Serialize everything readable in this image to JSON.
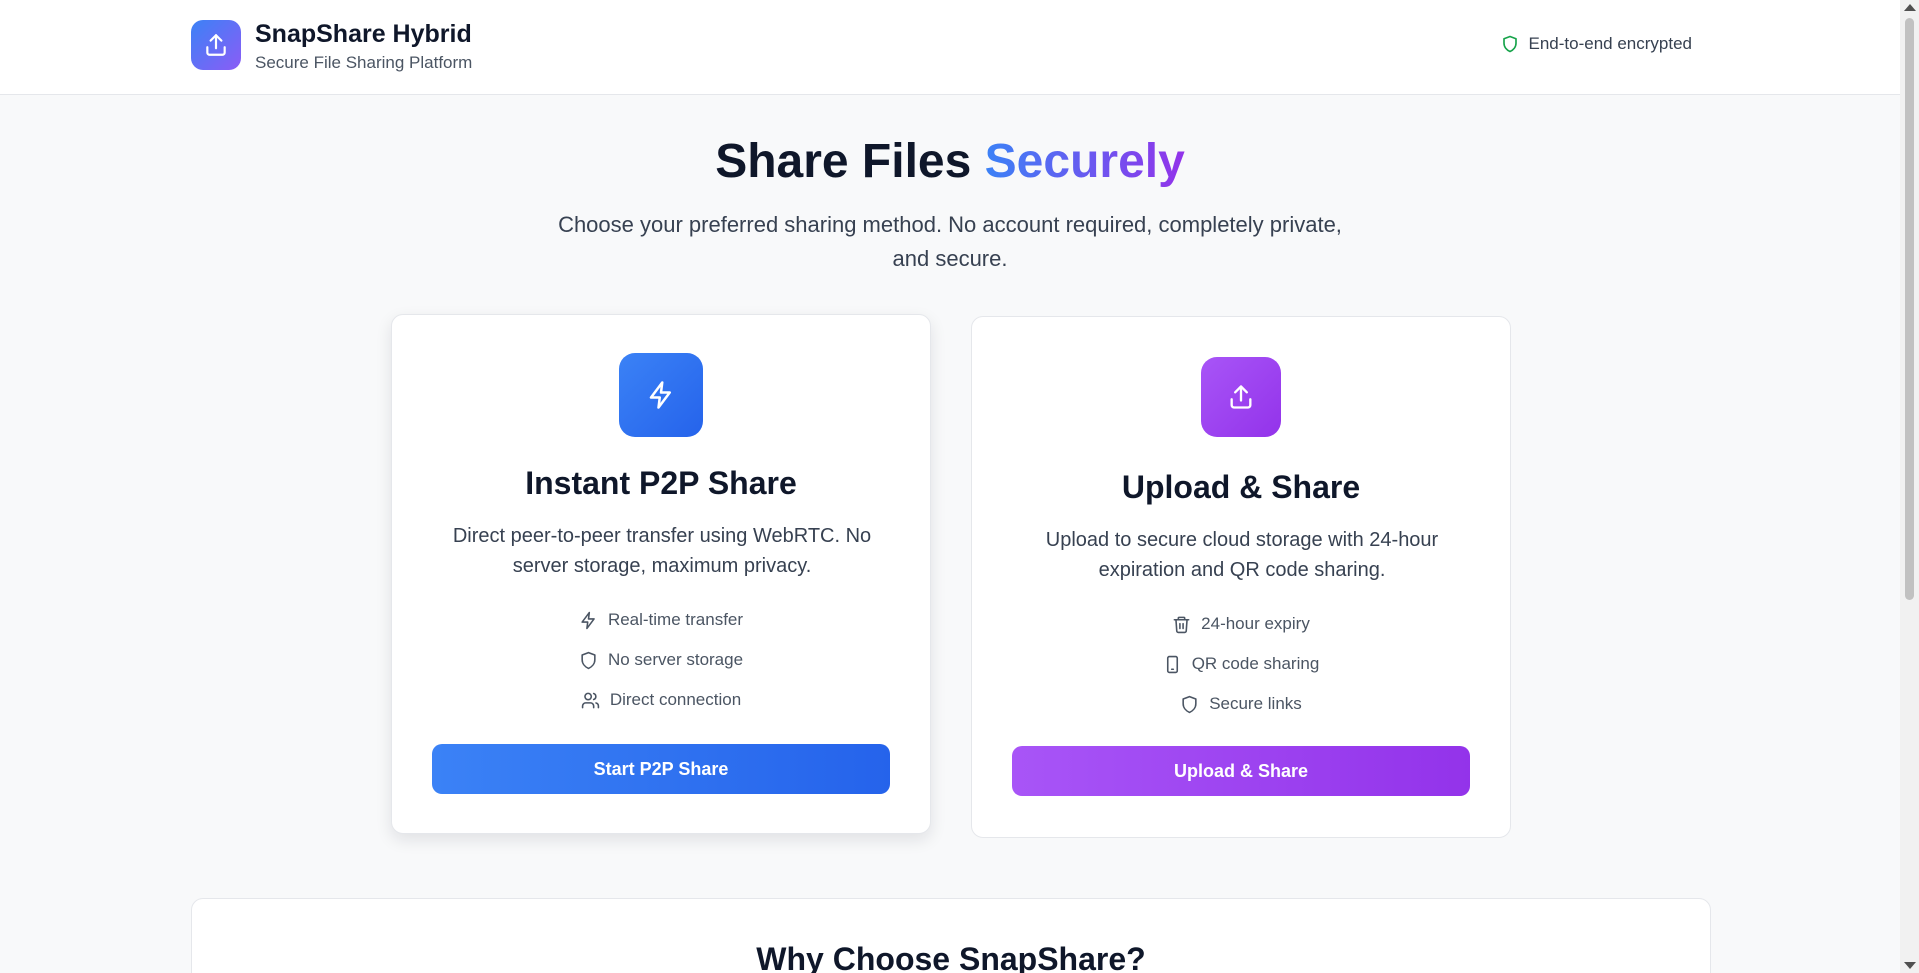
{
  "header": {
    "app_name": "SnapShare Hybrid",
    "tagline": "Secure File Sharing Platform",
    "security_badge": "End-to-end encrypted",
    "logo_icon": "upload-icon",
    "badge_icon": "shield-icon"
  },
  "hero": {
    "title_main": "Share Files",
    "title_accent": "Securely",
    "description": "Choose your preferred sharing method. No account required, completely private, and secure."
  },
  "cards": {
    "p2p": {
      "icon": "lightning-icon",
      "title": "Instant P2P Share",
      "description": "Direct peer-to-peer transfer using WebRTC. No server storage, maximum privacy.",
      "features": [
        {
          "icon": "lightning-icon",
          "label": "Real-time transfer"
        },
        {
          "icon": "shield-icon",
          "label": "No server storage"
        },
        {
          "icon": "users-icon",
          "label": "Direct connection"
        }
      ],
      "button_label": "Start P2P Share",
      "accent": "#3b82f6"
    },
    "upload": {
      "icon": "upload-icon",
      "title": "Upload & Share",
      "description": "Upload to secure cloud storage with 24-hour expiration and QR code sharing.",
      "features": [
        {
          "icon": "trash-icon",
          "label": "24-hour expiry"
        },
        {
          "icon": "smartphone-icon",
          "label": "QR code sharing"
        },
        {
          "icon": "shield-icon",
          "label": "Secure links"
        }
      ],
      "button_label": "Upload & Share",
      "accent": "#a855f7"
    }
  },
  "why": {
    "title": "Why Choose SnapShare?"
  },
  "colors": {
    "brand_gradient_start": "#3b82f6",
    "brand_gradient_end": "#9333ea",
    "secure_green": "#16a34a"
  }
}
